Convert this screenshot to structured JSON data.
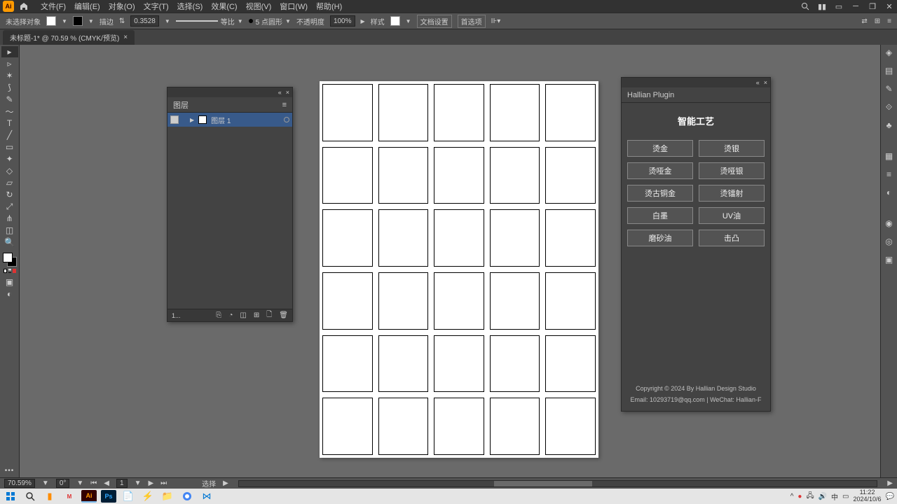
{
  "menu": {
    "items": [
      "文件(F)",
      "编辑(E)",
      "对象(O)",
      "文字(T)",
      "选择(S)",
      "效果(C)",
      "视图(V)",
      "窗口(W)",
      "帮助(H)"
    ]
  },
  "ctrl": {
    "noselect": "未选择对象",
    "stroke_label": "描边",
    "stroke_val": "0.3528",
    "dash_opt": "等比",
    "pt": "5 点圆形",
    "opacity_label": "不透明度",
    "opacity_val": "100%",
    "style_label": "样式",
    "docsetup": "文档设置",
    "prefs": "首选项"
  },
  "doctab": {
    "name": "未标题-1* @ 70.59 % (CMYK/预览)"
  },
  "layers_panel": {
    "title": "图层",
    "row_name": "图层 1",
    "count": "1..."
  },
  "plugin": {
    "name": "Hallian Plugin",
    "title": "智能工艺",
    "buttons": [
      "烫金",
      "烫银",
      "烫哑金",
      "烫哑银",
      "烫古铜金",
      "烫镭射",
      "白墨",
      "UV油",
      "磨砂油",
      "击凸"
    ],
    "copyright": "Copyright © 2024 By Hallian Design Studio",
    "contact": "Email: 10293719@qq.com | WeChat: Hallian-F"
  },
  "status": {
    "zoom": "70.59%",
    "rotate": "0°",
    "page": "1",
    "mode": "选择"
  },
  "clock": {
    "time": "11:22",
    "date": "2024/10/6"
  }
}
